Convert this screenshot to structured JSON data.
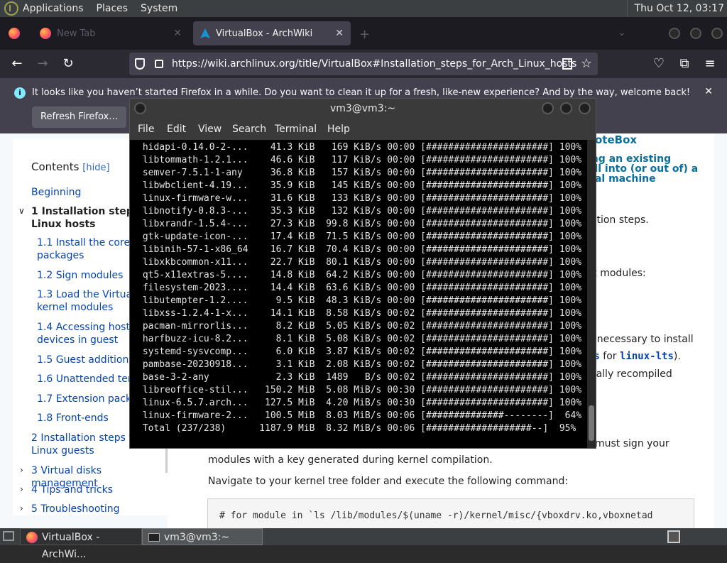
{
  "top_panel": {
    "menus": [
      "Applications",
      "Places",
      "System"
    ],
    "clock": "Thu Oct 12, 03:17"
  },
  "browser": {
    "tabs": [
      {
        "label": "New Tab",
        "active": false
      },
      {
        "label": "VirtualBox - ArchWiki",
        "active": true
      }
    ],
    "url": "https://wiki.archlinux.org/title/VirtualBox#Installation_steps_for_Arch_Linux_hosts",
    "notification": {
      "message": "It looks like you haven’t started Firefox in a while. Do you want to clean it up for a fresh, like-new experience? And by the way, welcome back!",
      "button": "Refresh Firefox…"
    }
  },
  "toc": {
    "title": "Contents",
    "hide": "[hide]",
    "items": [
      {
        "label": "Beginning"
      },
      {
        "label": "1  Installation steps for Arch Linux hosts",
        "line1": "1  Installation steps f",
        "line2": "Linux hosts"
      },
      {
        "label": "1.1  Install the core packages",
        "line1": "1.1  Install the core",
        "line2": "packages"
      },
      {
        "label": "1.2  Sign modules"
      },
      {
        "label": "1.3  Load the VirtualBox kernel modules",
        "line1": "1.3  Load the VirtualB",
        "line2": "kernel modules"
      },
      {
        "label": "1.4  Accessing host USB devices in guest",
        "line1": "1.4  Accessing host U",
        "line2": "devices in guest"
      },
      {
        "label": "1.5  Guest additions"
      },
      {
        "label": "1.6  Unattended temp"
      },
      {
        "label": "1.7  Extension pack"
      },
      {
        "label": "1.8  Front-ends"
      },
      {
        "label": "2  Installation steps for Arch Linux guests",
        "line1": "2  Installation steps for",
        "line2": "Linux guests"
      },
      {
        "label": "3  Virtual disks management"
      },
      {
        "label": "4  Tips and tricks"
      },
      {
        "label": "5  Troubleshooting"
      }
    ]
  },
  "article": {
    "note_title": "oteBox",
    "note_lines": [
      "ing an existing",
      "all into (or out of) a",
      "ual machine"
    ],
    "fragments": {
      "installation_steps": "lation steps.",
      "host_modules": "st modules:",
      "necessary": "y necessary to install",
      "rs_for": "rs",
      "for_word": " for ",
      "lts": "linux-lts",
      "lts_end": ").",
      "recompiled": "ically recompiled",
      "must_sign": "must sign your",
      "modules_key": "modules with a key generated during kernel compilation.",
      "navigate": "Navigate to your kernel tree folder and execute the following command:",
      "code": "# for module in `ls /lib/modules/$(uname -r)/kernel/misc/{vboxdrv.ko,vboxnetad"
    }
  },
  "terminal": {
    "title": "vm3@vm3:~",
    "menus": [
      "File",
      "Edit",
      "View",
      "Search",
      "Terminal",
      "Help"
    ],
    "lines": [
      " hidapi-0.14.0-2-...    41.3 KiB   169 KiB/s 00:00 [######################] 100%",
      " libtommath-1.2.1...    46.6 KiB   117 KiB/s 00:00 [######################] 100%",
      " semver-7.5.1-1-any     36.8 KiB   157 KiB/s 00:00 [######################] 100%",
      " libwbclient-4.19...    35.9 KiB   145 KiB/s 00:00 [######################] 100%",
      " linux-firmware-w...    31.6 KiB   133 KiB/s 00:00 [######################] 100%",
      " libnotify-0.8.3-...    35.3 KiB   132 KiB/s 00:00 [######################] 100%",
      " libxrandr-1.5.4-...    27.3 KiB  99.8 KiB/s 00:00 [######################] 100%",
      " gtk-update-icon-...    17.4 KiB  71.5 KiB/s 00:00 [######################] 100%",
      " libinih-57-1-x86_64    16.7 KiB  70.4 KiB/s 00:00 [######################] 100%",
      " libxkbcommon-x11...    22.7 KiB  80.1 KiB/s 00:00 [######################] 100%",
      " qt5-x11extras-5....    14.8 KiB  64.2 KiB/s 00:00 [######################] 100%",
      " filesystem-2023....    14.4 KiB  63.6 KiB/s 00:00 [######################] 100%",
      " libutempter-1.2....     9.5 KiB  48.3 KiB/s 00:00 [######################] 100%",
      " libxss-1.2.4-1-x...    14.1 KiB  8.58 KiB/s 00:02 [######################] 100%",
      " pacman-mirrorlis...     8.2 KiB  5.05 KiB/s 00:02 [######################] 100%",
      " harfbuzz-icu-8.2...     8.1 KiB  5.08 KiB/s 00:02 [######################] 100%",
      " systemd-sysvcomp...     6.0 KiB  3.87 KiB/s 00:02 [######################] 100%",
      " pambase-20230918...     3.1 KiB  2.08 KiB/s 00:02 [######################] 100%",
      " base-3-2-any            2.3 KiB  1489   B/s 00:02 [######################] 100%",
      " libreoffice-stil...   150.2 MiB  5.08 MiB/s 00:30 [######################] 100%",
      " linux-6.5.7.arch...   127.5 MiB  4.20 MiB/s 00:30 [######################] 100%",
      " linux-firmware-2...   100.5 MiB  8.03 MiB/s 00:06 [##############--------]  64%",
      " Total (237/238)      1187.9 MiB  8.32 MiB/s 00:06 [###################--]  95%"
    ]
  },
  "taskbar": {
    "tasks": [
      "VirtualBox - ArchWi...",
      "vm3@vm3:~"
    ]
  }
}
